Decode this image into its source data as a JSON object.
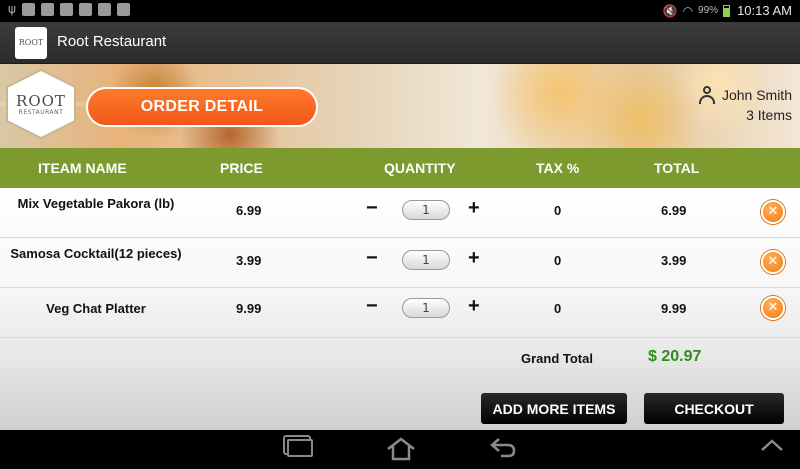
{
  "status_bar": {
    "battery_pct": "99%",
    "time": "10:13 AM"
  },
  "action_bar": {
    "title": "Root Restaurant",
    "app_icon_text": "ROOT"
  },
  "banner": {
    "logo_text": "ROOT",
    "logo_sub": "RESTAURANT",
    "order_detail_label": "ORDER DETAIL",
    "user_name": "John Smith",
    "items_count": "3 Items"
  },
  "table": {
    "headers": {
      "name": "ITEAM NAME",
      "price": "PRICE",
      "quantity": "QUANTITY",
      "tax": "TAX %",
      "total": "TOTAL"
    },
    "rows": [
      {
        "name": "Mix Vegetable Pakora (lb)",
        "price": "6.99",
        "qty": "1",
        "tax": "0",
        "total": "6.99"
      },
      {
        "name": "Samosa Cocktail(12 pieces)",
        "price": "3.99",
        "qty": "1",
        "tax": "0",
        "total": "3.99"
      },
      {
        "name": "Veg Chat Platter",
        "price": "9.99",
        "qty": "1",
        "tax": "0",
        "total": "9.99"
      }
    ],
    "minus_symbol": "−",
    "plus_symbol": "+",
    "remove_symbol": "✕"
  },
  "summary": {
    "grand_total_label": "Grand Total",
    "grand_total_value": "$ 20.97"
  },
  "buttons": {
    "add_more": "ADD MORE ITEMS",
    "checkout": "CHECKOUT"
  },
  "colors": {
    "header_green": "#7d9a2e",
    "accent_orange": "#f0581a",
    "total_green": "#2f8a1f"
  }
}
